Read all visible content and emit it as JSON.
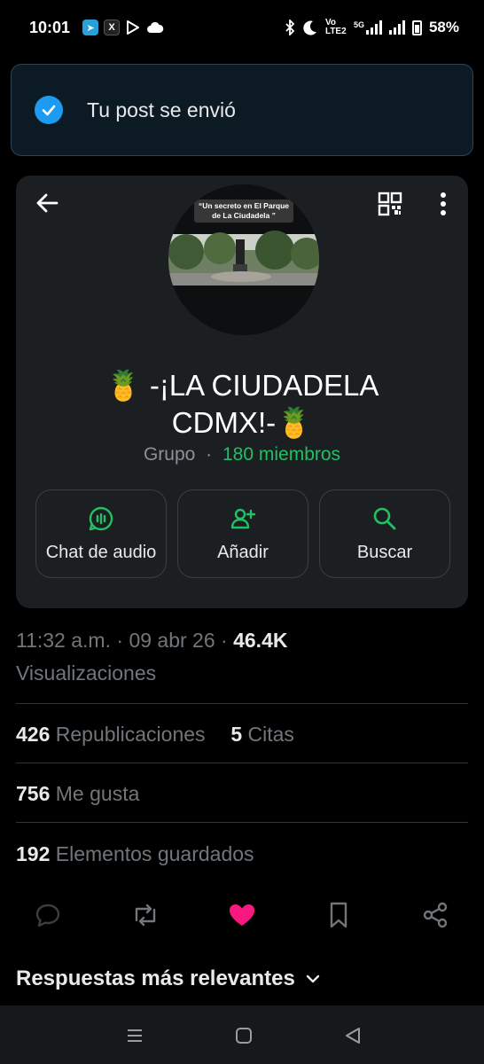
{
  "status_bar": {
    "time": "10:01",
    "battery": "58%",
    "network": "5G",
    "volte": "Vo LTE2"
  },
  "toast": {
    "message": "Tu post se envió"
  },
  "group": {
    "photo_caption": "“Un secreto en El Parque de La Ciudadela ”",
    "title_line1": "🍍 -¡LA CIUDADELA",
    "title_line2": "CDMX!-🍍",
    "type": "Grupo",
    "separator": "·",
    "members": "180 miembros",
    "actions": [
      {
        "label": "Chat de audio",
        "icon": "audio-chat-icon"
      },
      {
        "label": "Añadir",
        "icon": "add-person-icon"
      },
      {
        "label": "Buscar",
        "icon": "search-icon"
      }
    ]
  },
  "tweet": {
    "time": "11:32 a.m.",
    "date": "09 abr 26",
    "views_count": "46.4K",
    "views_label": "Visualizaciones",
    "reposts_count": "426",
    "reposts_label": "Republicaciones",
    "quotes_count": "5",
    "quotes_label": "Citas",
    "likes_count": "756",
    "likes_label": "Me gusta",
    "bookmarks_count": "192",
    "bookmarks_label": "Elementos guardados",
    "liked": true
  },
  "replies": {
    "header": "Respuestas más relevantes"
  },
  "colors": {
    "accent_blue": "#1d9bf0",
    "whatsapp_green": "#21c063",
    "like_pink": "#f91880"
  }
}
